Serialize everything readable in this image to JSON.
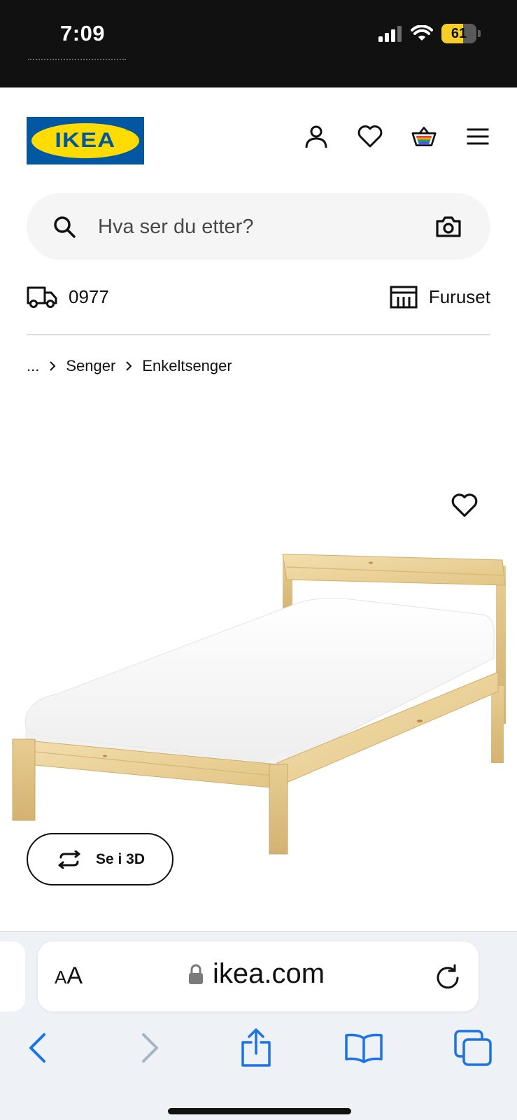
{
  "status_bar": {
    "time": "7:09",
    "battery_level": "61",
    "battery_fraction": 0.61,
    "icons": [
      "cellular-signal-icon",
      "wifi-icon",
      "battery-icon"
    ]
  },
  "header": {
    "logo_text": "IKEA",
    "logo_colors": {
      "background": "#0058a3",
      "oval": "#ffdb00"
    },
    "icons": [
      "user-icon",
      "heart-icon",
      "shopping-bag-icon",
      "menu-icon"
    ]
  },
  "search": {
    "placeholder": "Hva ser du etter?",
    "icons": [
      "search-icon",
      "camera-icon"
    ]
  },
  "info_row": {
    "delivery_postcode": "0977",
    "store_name": "Furuset",
    "icons": [
      "delivery-truck-icon",
      "store-icon"
    ]
  },
  "breadcrumb": {
    "ellipsis": "...",
    "items": [
      "Senger",
      "Enkeltsenger"
    ]
  },
  "product": {
    "view_3d_label": "Se i 3D",
    "icons": [
      "heart-icon",
      "rotate-3d-icon"
    ]
  },
  "browser": {
    "text_size_label_small": "A",
    "text_size_label_large": "A",
    "url": "ikea.com",
    "accent_color": "#1a73e8",
    "icons": [
      "lock-icon",
      "reload-icon",
      "back-icon",
      "forward-icon",
      "share-icon",
      "bookmarks-icon",
      "tabs-icon"
    ]
  }
}
